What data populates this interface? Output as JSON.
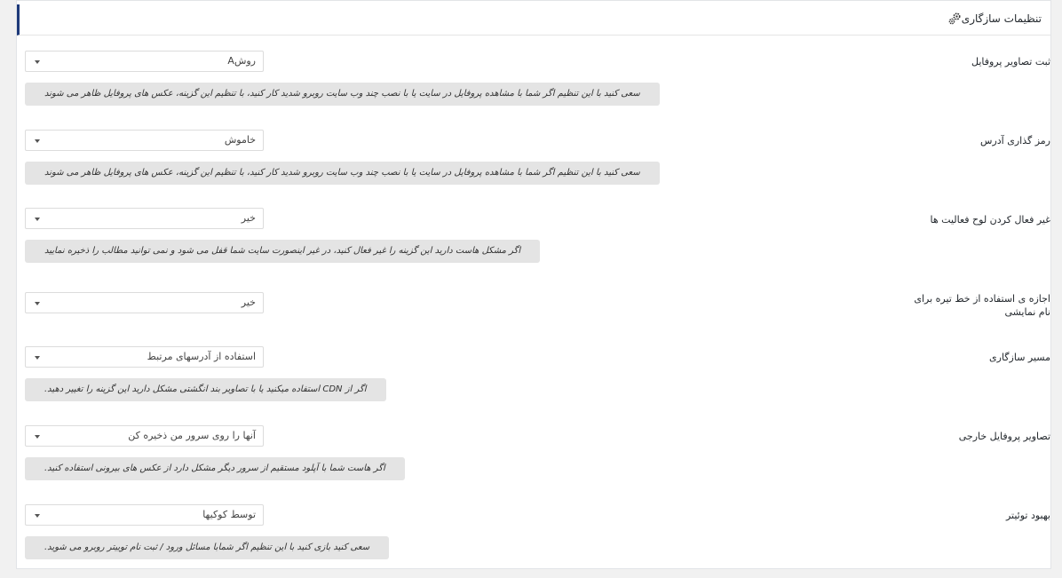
{
  "header": {
    "title": "تنظیمات سازگاری",
    "icon": "gears-icon"
  },
  "colors": {
    "accent": "#1e3a7a",
    "description_bg": "#e4e4e4"
  },
  "settings": [
    {
      "label": "ثبت تصاویر پروفایل",
      "value": "روشA",
      "description": "سعی کنید با این تنظیم اگر شما با مشاهده پروفایل در سایت یا با نصب چند وب سایت روبرو شدید کار کنید، با تنظیم این گزینه، عکس های پروفایل ظاهر می شوند"
    },
    {
      "label": "رمز گذاری آدرس",
      "value": "خاموش",
      "description": "سعی کنید با این تنظیم اگر شما با مشاهده پروفایل در سایت یا با نصب چند وب سایت روبرو شدید کار کنید، با تنظیم این گزینه، عکس های پروفایل ظاهر می شوند"
    },
    {
      "label": "غیر فعال کردن لوح فعالیت ها",
      "value": "خیر",
      "description": "اگر مشکل هاست دارید این گزینه را غیر فعال کنید، در غیر اینصورت سایت شما قفل می شود و نمی توانید مطالب را ذخیره نمایید"
    },
    {
      "label": "اجازه ی استفاده از خط تیره برای نام نمایشی",
      "value": "خیر"
    },
    {
      "label": "مسیر سازگاری",
      "value": "استفاده از آدرسهای مرتبط",
      "description": "اگر از CDN استفاده میکنید یا با تصاویر بند انگشتی مشکل دارید این گزینه را تغییر دهید."
    },
    {
      "label": "تصاویر پروفایل خارجی",
      "value": "آنها را روی سرور من ذخیره کن",
      "description": "اگر هاست شما با آپلود مستقیم از سرور دیگر مشکل دارد از عکس های بیرونی استفاده کنید."
    },
    {
      "label": "بهبود توئیتر",
      "value": "توسط کوکیها",
      "description": "سعی کنید بازی کنید با این تنظیم اگر شمابا مسائل ورود / ثبت نام توییتر روبرو می شوید."
    }
  ]
}
